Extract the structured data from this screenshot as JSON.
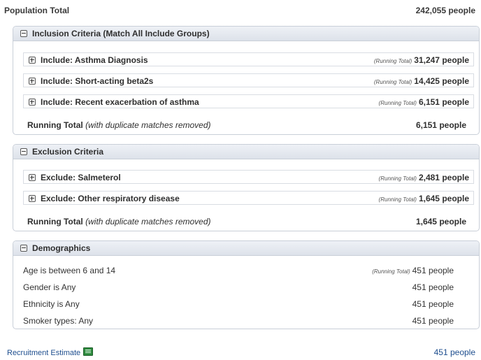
{
  "population": {
    "label": "Population Total",
    "value": "242,055 people"
  },
  "inclusion": {
    "title": "Inclusion Criteria (Match All Include Groups)",
    "items": [
      {
        "label": "Include: Asthma Diagnosis",
        "total_prefix": "(Running Total)",
        "total": "31,247 people"
      },
      {
        "label": "Include: Short-acting beta2s",
        "total_prefix": "(Running Total)",
        "total": "14,425 people"
      },
      {
        "label": "Include: Recent exacerbation of asthma",
        "total_prefix": "(Running Total)",
        "total": "6,151 people"
      }
    ],
    "running_label": "Running Total",
    "running_note": "(with duplicate matches removed)",
    "running_value": "6,151 people"
  },
  "exclusion": {
    "title": "Exclusion Criteria",
    "items": [
      {
        "label": "Exclude: Salmeterol",
        "total_prefix": "(Running Total)",
        "total": "2,481 people"
      },
      {
        "label": "Exclude: Other respiratory disease",
        "total_prefix": "(Running Total)",
        "total": "1,645 people"
      }
    ],
    "running_label": "Running Total",
    "running_note": "(with duplicate matches removed)",
    "running_value": "1,645 people"
  },
  "demographics": {
    "title": "Demographics",
    "rows": [
      {
        "label": "Age is between 6 and 14",
        "total_prefix": "(Running Total)",
        "value": "451 people"
      },
      {
        "label": "Gender is Any",
        "total_prefix": "",
        "value": "451 people"
      },
      {
        "label": "Ethnicity is Any",
        "total_prefix": "",
        "value": "451 people"
      },
      {
        "label": "Smoker types: Any",
        "total_prefix": "",
        "value": "451 people"
      }
    ]
  },
  "recruitment": {
    "label": "Recruitment Estimate",
    "value": "451 people",
    "icon": "excel-export-icon"
  },
  "colors": {
    "link": "#1f4f8f",
    "panel_border": "#c9cfd8",
    "header_bg": "#dde2ea"
  }
}
